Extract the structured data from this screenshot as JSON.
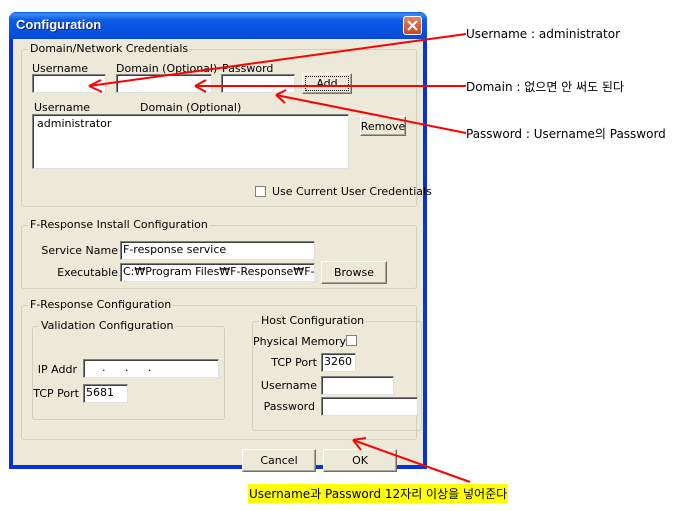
{
  "window": {
    "title": "Configuration"
  },
  "credentials": {
    "group_label": "Domain/Network Credentials",
    "username_label": "Username",
    "domain_label": "Domain (Optional)",
    "password_label": "Password",
    "username_value": "",
    "domain_value": "",
    "password_value": "",
    "add_label": "Add",
    "list_headers": [
      "Username",
      "Domain (Optional)"
    ],
    "list_items": [
      {
        "username": "administrator",
        "domain": ""
      }
    ],
    "remove_label": "Remove",
    "use_current_label": "Use Current User Credentials",
    "use_current_checked": false
  },
  "install": {
    "group_label": "F-Response Install Configuration",
    "service_name_label": "Service Name",
    "service_name_value": "F-response service",
    "executable_label": "Executable",
    "executable_value": "C:₩Program Files₩F-Response₩F-Res",
    "browse_label": "Browse"
  },
  "fresponse": {
    "group_label": "F-Response Configuration",
    "validation": {
      "group_label": "Validation Configuration",
      "ip_label": "IP Addr",
      "ip_value": "   .   .   .",
      "tcp_port_label": "TCP Port",
      "tcp_port_value": "5681"
    },
    "host": {
      "group_label": "Host Configuration",
      "physical_memory_label": "Physical Memory",
      "physical_memory_checked": false,
      "tcp_port_label": "TCP Port",
      "tcp_port_value": "3260",
      "username_label": "Username",
      "username_value": "",
      "password_label": "Password",
      "password_value": ""
    }
  },
  "footer": {
    "cancel_label": "Cancel",
    "ok_label": "OK"
  },
  "annotations": {
    "username_note": "Username : administrator",
    "domain_note": "Domain : 없으면 안 써도 된다",
    "password_note": "Password : Username의 Password",
    "ok_note": "Username과  Password 12자리 이상을 넣어준다",
    "arrow_color": "#ff0000",
    "highlight_color": "#ffff00"
  }
}
